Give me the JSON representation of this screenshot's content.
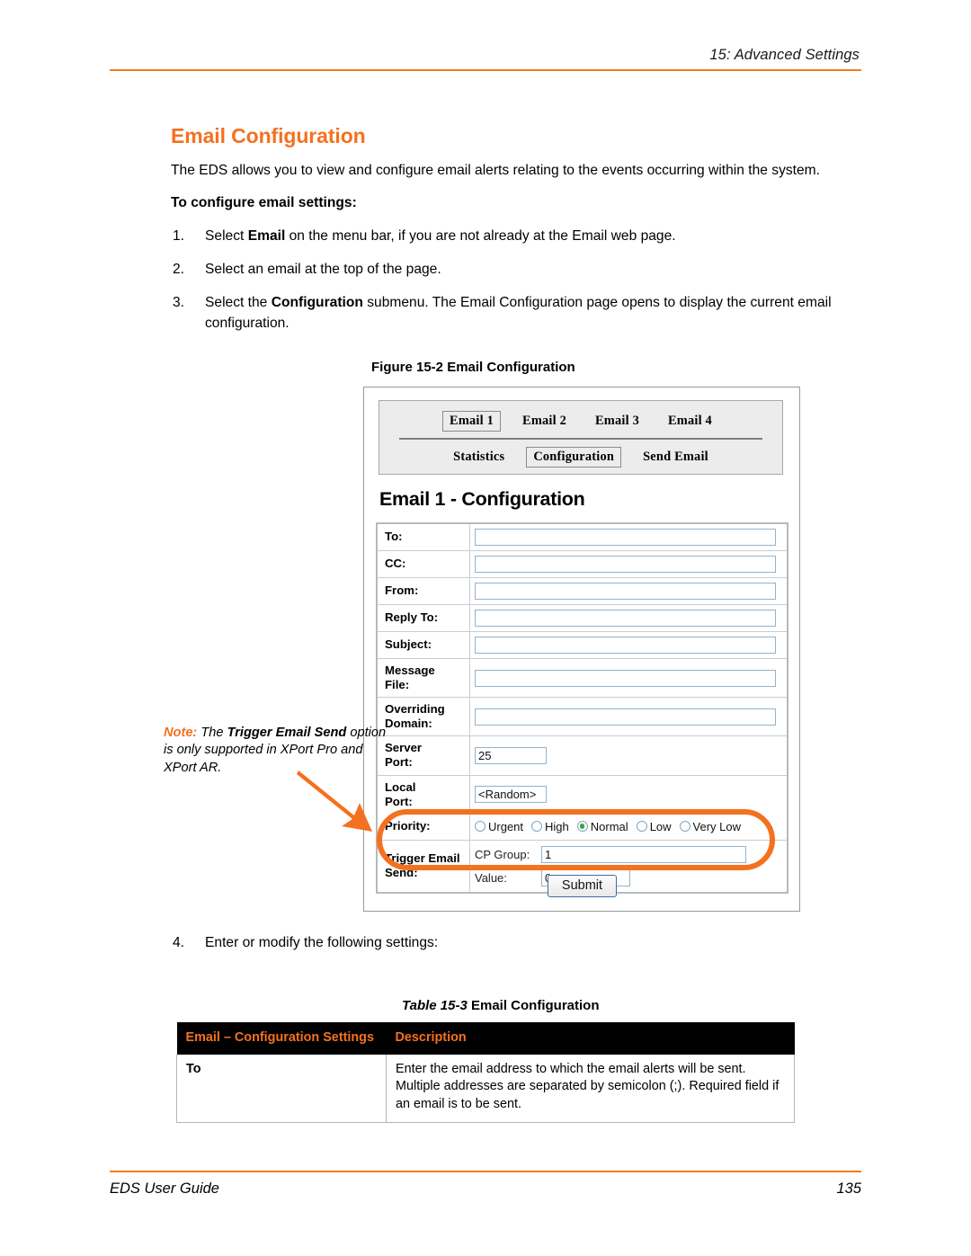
{
  "header": {
    "chapter_title": "15: Advanced Settings"
  },
  "section": {
    "title": "Email Configuration",
    "intro": "The EDS allows you to view and configure email alerts relating to the events occurring within the system.",
    "procedure_heading": "To configure email settings:",
    "steps": [
      {
        "number": "1.",
        "parts": [
          {
            "text": "Select ",
            "bold": false
          },
          {
            "text": "Email",
            "bold": true
          },
          {
            "text": " on the menu bar, if you are not already at the Email web page.",
            "bold": false
          }
        ]
      },
      {
        "number": "2.",
        "parts": [
          {
            "text": "Select an email at the top of the page.",
            "bold": false
          }
        ]
      },
      {
        "number": "3.",
        "parts": [
          {
            "text": "Select the ",
            "bold": false
          },
          {
            "text": "Configuration",
            "bold": true
          },
          {
            "text": " submenu.  The Email Configuration page opens to display the current email configuration.",
            "bold": false
          }
        ]
      }
    ],
    "step4": {
      "number": "4.",
      "text": "Enter or modify the following settings:"
    }
  },
  "figure": {
    "caption_number": "Figure 15-2",
    "caption_text": "Email Configuration",
    "screenshot": {
      "email_tabs": [
        {
          "label": "Email 1",
          "selected": true
        },
        {
          "label": "Email 2",
          "selected": false
        },
        {
          "label": "Email 3",
          "selected": false
        },
        {
          "label": "Email 4",
          "selected": false
        }
      ],
      "submenu_tabs": [
        {
          "label": "Statistics",
          "selected": false
        },
        {
          "label": "Configuration",
          "selected": true
        },
        {
          "label": "Send Email",
          "selected": false
        }
      ],
      "panel_heading": "Email 1 - Configuration",
      "fields": [
        {
          "label": "To:",
          "value": "",
          "size": "wide"
        },
        {
          "label": "CC:",
          "value": "",
          "size": "wide"
        },
        {
          "label": "From:",
          "value": "",
          "size": "wide"
        },
        {
          "label": "Reply To:",
          "value": "",
          "size": "wide"
        },
        {
          "label": "Subject:",
          "value": "",
          "size": "wide"
        },
        {
          "label": "Message File:",
          "value": "",
          "size": "wide"
        },
        {
          "label": "Overriding Domain:",
          "value": "",
          "size": "wide"
        },
        {
          "label": "Server Port:",
          "value": "25",
          "size": "small"
        },
        {
          "label": "Local Port:",
          "value": "<Random>",
          "size": "small"
        }
      ],
      "priority": {
        "label": "Priority:",
        "options": [
          {
            "label": "Urgent",
            "selected": false
          },
          {
            "label": "High",
            "selected": false
          },
          {
            "label": "Normal",
            "selected": true
          },
          {
            "label": "Low",
            "selected": false
          },
          {
            "label": "Very Low",
            "selected": false
          }
        ]
      },
      "trigger": {
        "label": "Trigger Email Send:",
        "cp_group_label": "CP Group:",
        "cp_group_value": "1",
        "value_label": "Value:",
        "value_value": "0"
      },
      "submit_label": "Submit"
    }
  },
  "note": {
    "keyword": "Note:",
    "parts": [
      {
        "text": " The ",
        "bold": false
      },
      {
        "text": "Trigger Email Send",
        "bold": true
      },
      {
        "text": " option is only supported in XPort Pro and XPort AR.",
        "bold": false
      }
    ]
  },
  "table": {
    "caption_number": "Table 15-3",
    "caption_text": "Email Configuration",
    "headers": [
      "Email – Configuration Settings",
      "Description"
    ],
    "rows": [
      {
        "key": "To",
        "description": "Enter the email address to which the email alerts will be sent. Multiple addresses are separated by semicolon (;). Required field if an email is to be sent."
      }
    ]
  },
  "footer": {
    "guide_name": "EDS User Guide",
    "page_number": "135"
  },
  "colors": {
    "accent_orange": "#F4711F",
    "header_black": "#000000"
  }
}
